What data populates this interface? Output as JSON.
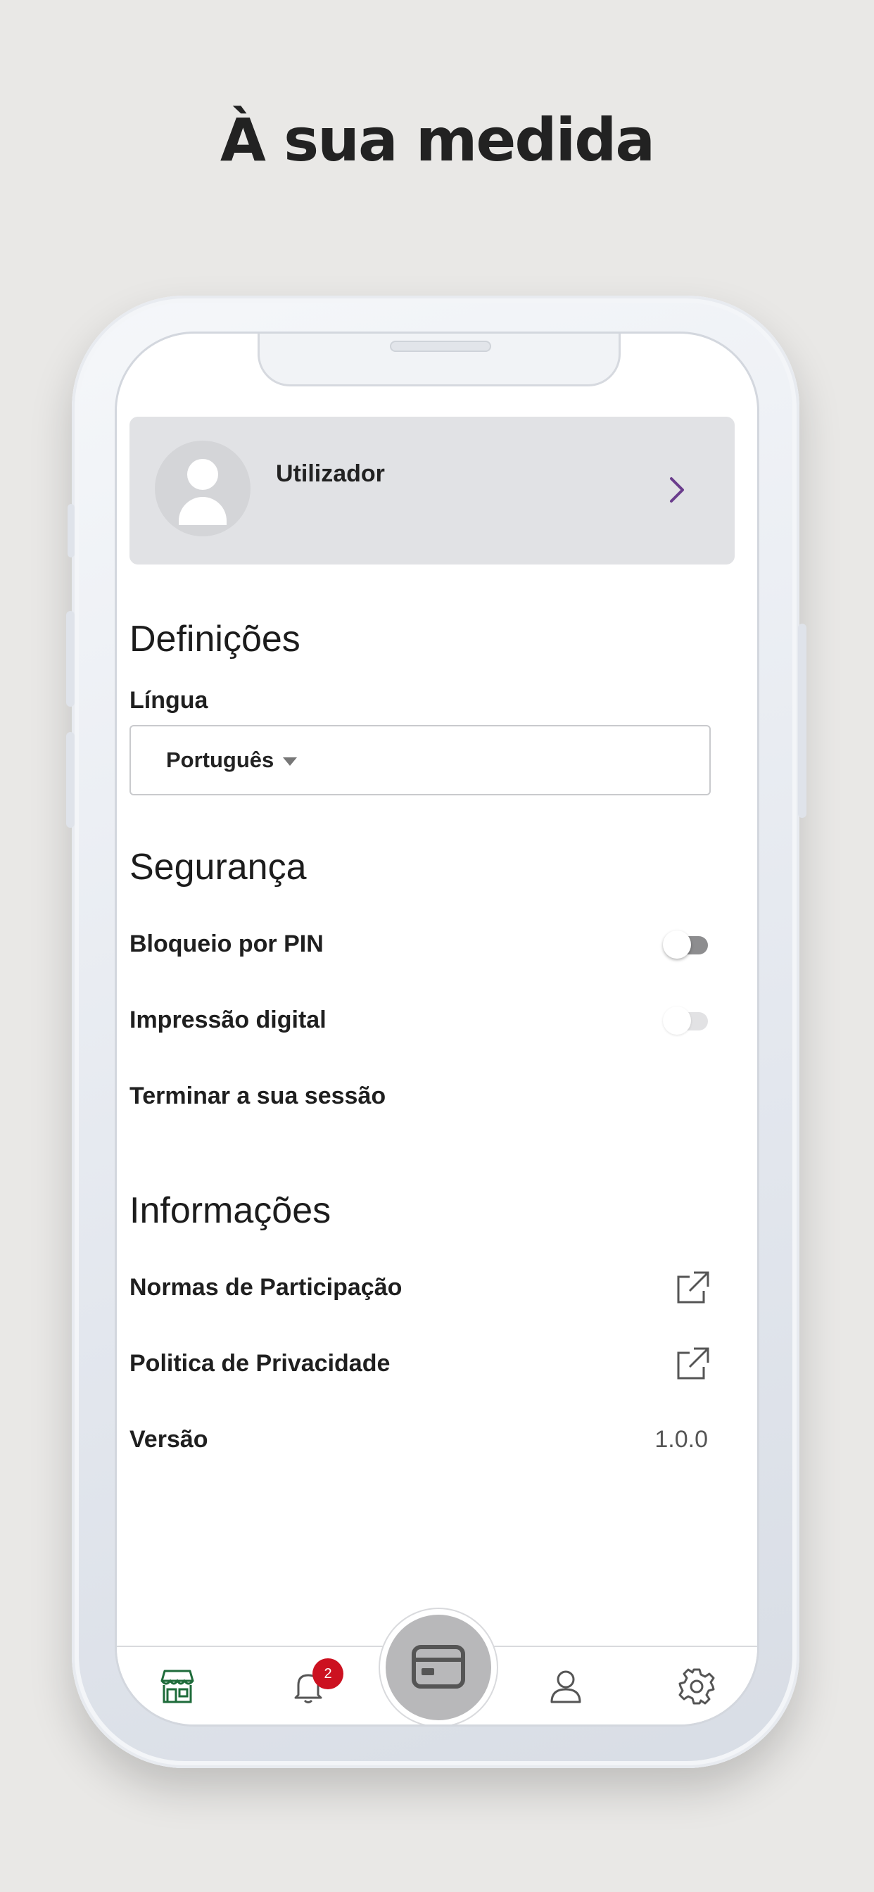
{
  "headline": "À sua medida",
  "user": {
    "name": "Utilizador"
  },
  "settings": {
    "title": "Definições",
    "language_label": "Língua",
    "language_value": "Português"
  },
  "security": {
    "title": "Segurança",
    "pin_label": "Bloqueio por PIN",
    "pin_enabled": false,
    "fingerprint_label": "Impressão digital",
    "fingerprint_enabled": false,
    "logout_label": "Terminar a sua sessão"
  },
  "info": {
    "title": "Informações",
    "rules_label": "Normas de Participação",
    "privacy_label": "Politica de Privacidade",
    "version_label": "Versão",
    "version_value": "1.0.0"
  },
  "tabbar": {
    "items": [
      {
        "icon": "store-icon",
        "active": true
      },
      {
        "icon": "bell-icon",
        "badge": "2"
      },
      {
        "icon": "card-icon",
        "center": true
      },
      {
        "icon": "user-icon"
      },
      {
        "icon": "gear-icon"
      }
    ]
  },
  "colors": {
    "accent_purple": "#6a3c8c",
    "active_tab_green": "#1e6b3a",
    "badge_red": "#cc1120",
    "toggle_track_pin": "#8d8d8f",
    "toggle_track_fingerprint": "#e2e2e4"
  }
}
